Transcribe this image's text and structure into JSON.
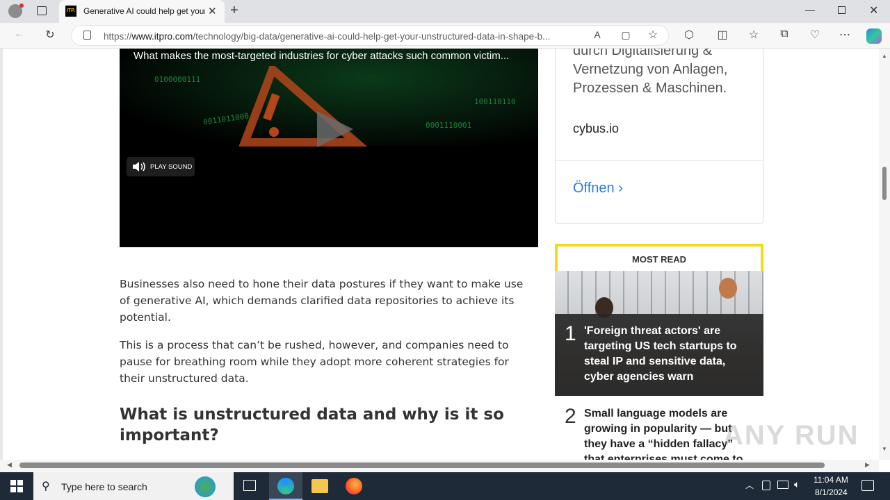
{
  "browser": {
    "tab_title": "Generative AI could help get your unstructured data in shape",
    "tab_favicon_text": "ITP.",
    "url_prefix": "https://",
    "url_domain": "www.itpro.com",
    "url_path": "/technology/big-data/generative-ai-could-help-get-your-unstructured-data-in-shape-b..."
  },
  "video": {
    "caption": "What makes the most-targeted industries for cyber attacks such common victim...",
    "play_sound_label": "PLAY SOUND",
    "digits_1": "0100000111",
    "digits_2": "0011011000",
    "digits_3": "0001110001",
    "digits_4": "100110110"
  },
  "article": {
    "p1": "Businesses also need to hone their data postures if they want to make use of generative AI, which demands clarified data repositories to achieve its potential.",
    "p2": "This is a process that can’t be rushed, however, and companies need to pause for breathing room while they adopt more coherent strategies for their unstructured data.",
    "h2": "What is unstructured data and why is it so important?"
  },
  "ad": {
    "text": "durch Digitalisierung & Vernetzung von Anlagen, Prozessen & Maschinen.",
    "domain": "cybus.io",
    "open_label": "Öffnen"
  },
  "most_read": {
    "header": "MOST READ",
    "items": [
      {
        "number": "1",
        "title": "'Foreign threat actors' are targeting US tech startups to steal IP and sensitive data, cyber agencies warn"
      },
      {
        "number": "2",
        "title": "Small language models are growing in popularity — but they have a “hidden fallacy” that enterprises must come to"
      }
    ]
  },
  "taskbar": {
    "search_placeholder": "Type here to search",
    "time": "11:04 AM",
    "date": "8/1/2024"
  },
  "watermark": "ANY RUN"
}
